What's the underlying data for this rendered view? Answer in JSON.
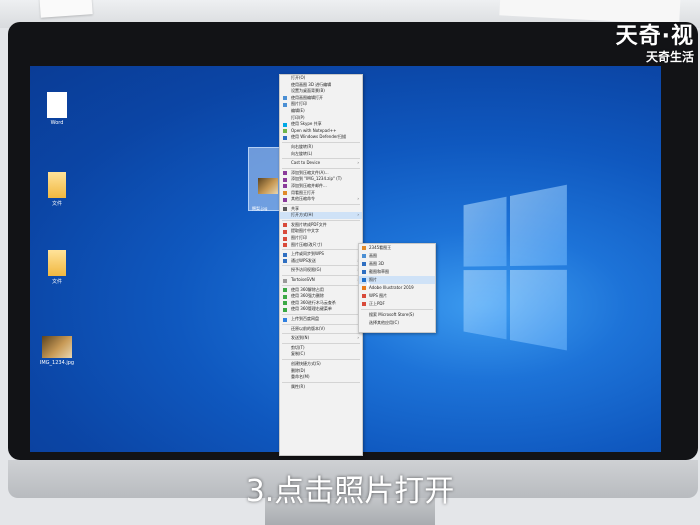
{
  "watermark": {
    "brand": "天奇·视",
    "sub": "天奇生活"
  },
  "caption": "3.点击照片打开",
  "desktop": {
    "icons": [
      {
        "label": "Word"
      },
      {
        "label": "文件"
      },
      {
        "label": "文件"
      },
      {
        "label": "IMG_1234.jpg"
      }
    ],
    "selected_label": "鳄梨.jpg"
  },
  "context_menu": {
    "items": [
      {
        "label": "打开(O)",
        "icon": "none",
        "color": ""
      },
      {
        "label": "使用画图 3D 进行编辑",
        "icon": "none",
        "color": ""
      },
      {
        "label": "设置为桌面背景(B)",
        "icon": "none",
        "color": ""
      },
      {
        "label": "使用画图编辑打开",
        "icon": "app-icon",
        "color": "#4a8fd4"
      },
      {
        "label": "图片打印",
        "icon": "app-icon",
        "color": "#4a8fd4"
      },
      {
        "label": "编辑(E)",
        "icon": "none",
        "color": ""
      },
      {
        "label": "打印(P)",
        "icon": "none",
        "color": ""
      },
      {
        "label": "使用 Skype 共享",
        "icon": "skype-icon",
        "color": "#00a8e6"
      },
      {
        "label": "Open with Notepad++",
        "icon": "notepad-icon",
        "color": "#6fb54a"
      },
      {
        "label": "使用 Windows Defender扫描",
        "icon": "shield-icon",
        "color": "#2f6fc1"
      },
      {
        "sep": true
      },
      {
        "label": "向右旋转(R)",
        "icon": "none",
        "color": ""
      },
      {
        "label": "向左旋转(L)",
        "icon": "none",
        "color": ""
      },
      {
        "sep": true
      },
      {
        "label": "Cast to Device",
        "icon": "none",
        "color": "",
        "arrow": true
      },
      {
        "sep": true
      },
      {
        "label": "添加到压缩文件(A)...",
        "icon": "archive-icon",
        "color": "#8a3a9a"
      },
      {
        "label": "添加到 \"IMG_1234.zip\" (T)",
        "icon": "archive-icon",
        "color": "#8a3a9a"
      },
      {
        "label": "添加到压缩并邮件...",
        "icon": "archive-icon",
        "color": "#8a3a9a"
      },
      {
        "label": "用看图王打开",
        "icon": "app-icon",
        "color": "#e08a2a"
      },
      {
        "label": "其他压缩命令",
        "icon": "archive-icon",
        "color": "#8a3a9a",
        "arrow": true
      },
      {
        "sep": true
      },
      {
        "label": "共享",
        "icon": "share-icon",
        "color": "#5a5a5a"
      },
      {
        "label": "打开方式(H)",
        "icon": "none",
        "color": "",
        "arrow": true,
        "highlight": true
      },
      {
        "sep": true
      },
      {
        "label": "发图片转成PDF文件",
        "icon": "pdf-icon",
        "color": "#d84a3a"
      },
      {
        "label": "提取图片中文字",
        "icon": "app-icon",
        "color": "#d84a3a"
      },
      {
        "label": "图片打印",
        "icon": "app-icon",
        "color": "#d84a3a"
      },
      {
        "label": "图片压缩(改尺寸)",
        "icon": "app-icon",
        "color": "#d84a3a"
      },
      {
        "sep": true
      },
      {
        "label": "上传或同步到WPS",
        "icon": "wps-icon",
        "color": "#2f6fc1"
      },
      {
        "label": "通过WPS发送",
        "icon": "wps-icon",
        "color": "#2f6fc1",
        "arrow": true
      },
      {
        "sep": true
      },
      {
        "label": "授予访问权限(G)",
        "icon": "none",
        "color": "",
        "arrow": true
      },
      {
        "sep": true
      },
      {
        "label": "TortoiseSVN",
        "icon": "svn-icon",
        "color": "#9a9a9a",
        "arrow": true
      },
      {
        "sep": true
      },
      {
        "label": "使用 360解除占用",
        "icon": "360-icon",
        "color": "#3aa845"
      },
      {
        "label": "使用 360强力删除",
        "icon": "360-icon",
        "color": "#3aa845"
      },
      {
        "label": "使用 360进行木马云查杀",
        "icon": "360-icon",
        "color": "#3aa845"
      },
      {
        "label": "使用 360管理右键菜单",
        "icon": "360-icon",
        "color": "#3aa845"
      },
      {
        "sep": true
      },
      {
        "label": "上传到百度网盘",
        "icon": "cloud-icon",
        "color": "#2f7fe0"
      },
      {
        "sep": true
      },
      {
        "label": "还原以前的版本(V)",
        "icon": "none",
        "color": ""
      },
      {
        "sep": true
      },
      {
        "label": "发送到(N)",
        "icon": "none",
        "color": "",
        "arrow": true
      },
      {
        "sep": true
      },
      {
        "label": "剪切(T)",
        "icon": "none",
        "color": ""
      },
      {
        "label": "复制(C)",
        "icon": "none",
        "color": ""
      },
      {
        "sep": true
      },
      {
        "label": "创建快捷方式(S)",
        "icon": "none",
        "color": ""
      },
      {
        "label": "删除(D)",
        "icon": "none",
        "color": ""
      },
      {
        "label": "重命名(M)",
        "icon": "none",
        "color": ""
      },
      {
        "sep": true
      },
      {
        "label": "属性(R)",
        "icon": "none",
        "color": ""
      }
    ]
  },
  "submenu": {
    "items": [
      {
        "label": "2345看图王",
        "icon": "app-icon",
        "color": "#e08a2a"
      },
      {
        "label": "画图",
        "icon": "paint-icon",
        "color": "#4a8fd4"
      },
      {
        "label": "画图 3D",
        "icon": "paint3d-icon",
        "color": "#2f6fc1"
      },
      {
        "label": "截图和草图",
        "icon": "snip-icon",
        "color": "#2f6fc1"
      },
      {
        "label": "照片",
        "icon": "photos-icon",
        "color": "#1f6fc9",
        "highlight": true
      },
      {
        "label": "Adobe Illustrator 2019",
        "icon": "ai-icon",
        "color": "#e87a1a"
      },
      {
        "label": "WPS 图片",
        "icon": "wps-icon",
        "color": "#d84a3a"
      },
      {
        "label": "正上PDF",
        "icon": "pdf-icon",
        "color": "#d84a3a"
      },
      {
        "sep": true
      },
      {
        "label": "搜索 Microsoft Store(S)",
        "icon": "none",
        "color": ""
      },
      {
        "label": "选择其他应用(C)",
        "icon": "none",
        "color": ""
      }
    ]
  }
}
